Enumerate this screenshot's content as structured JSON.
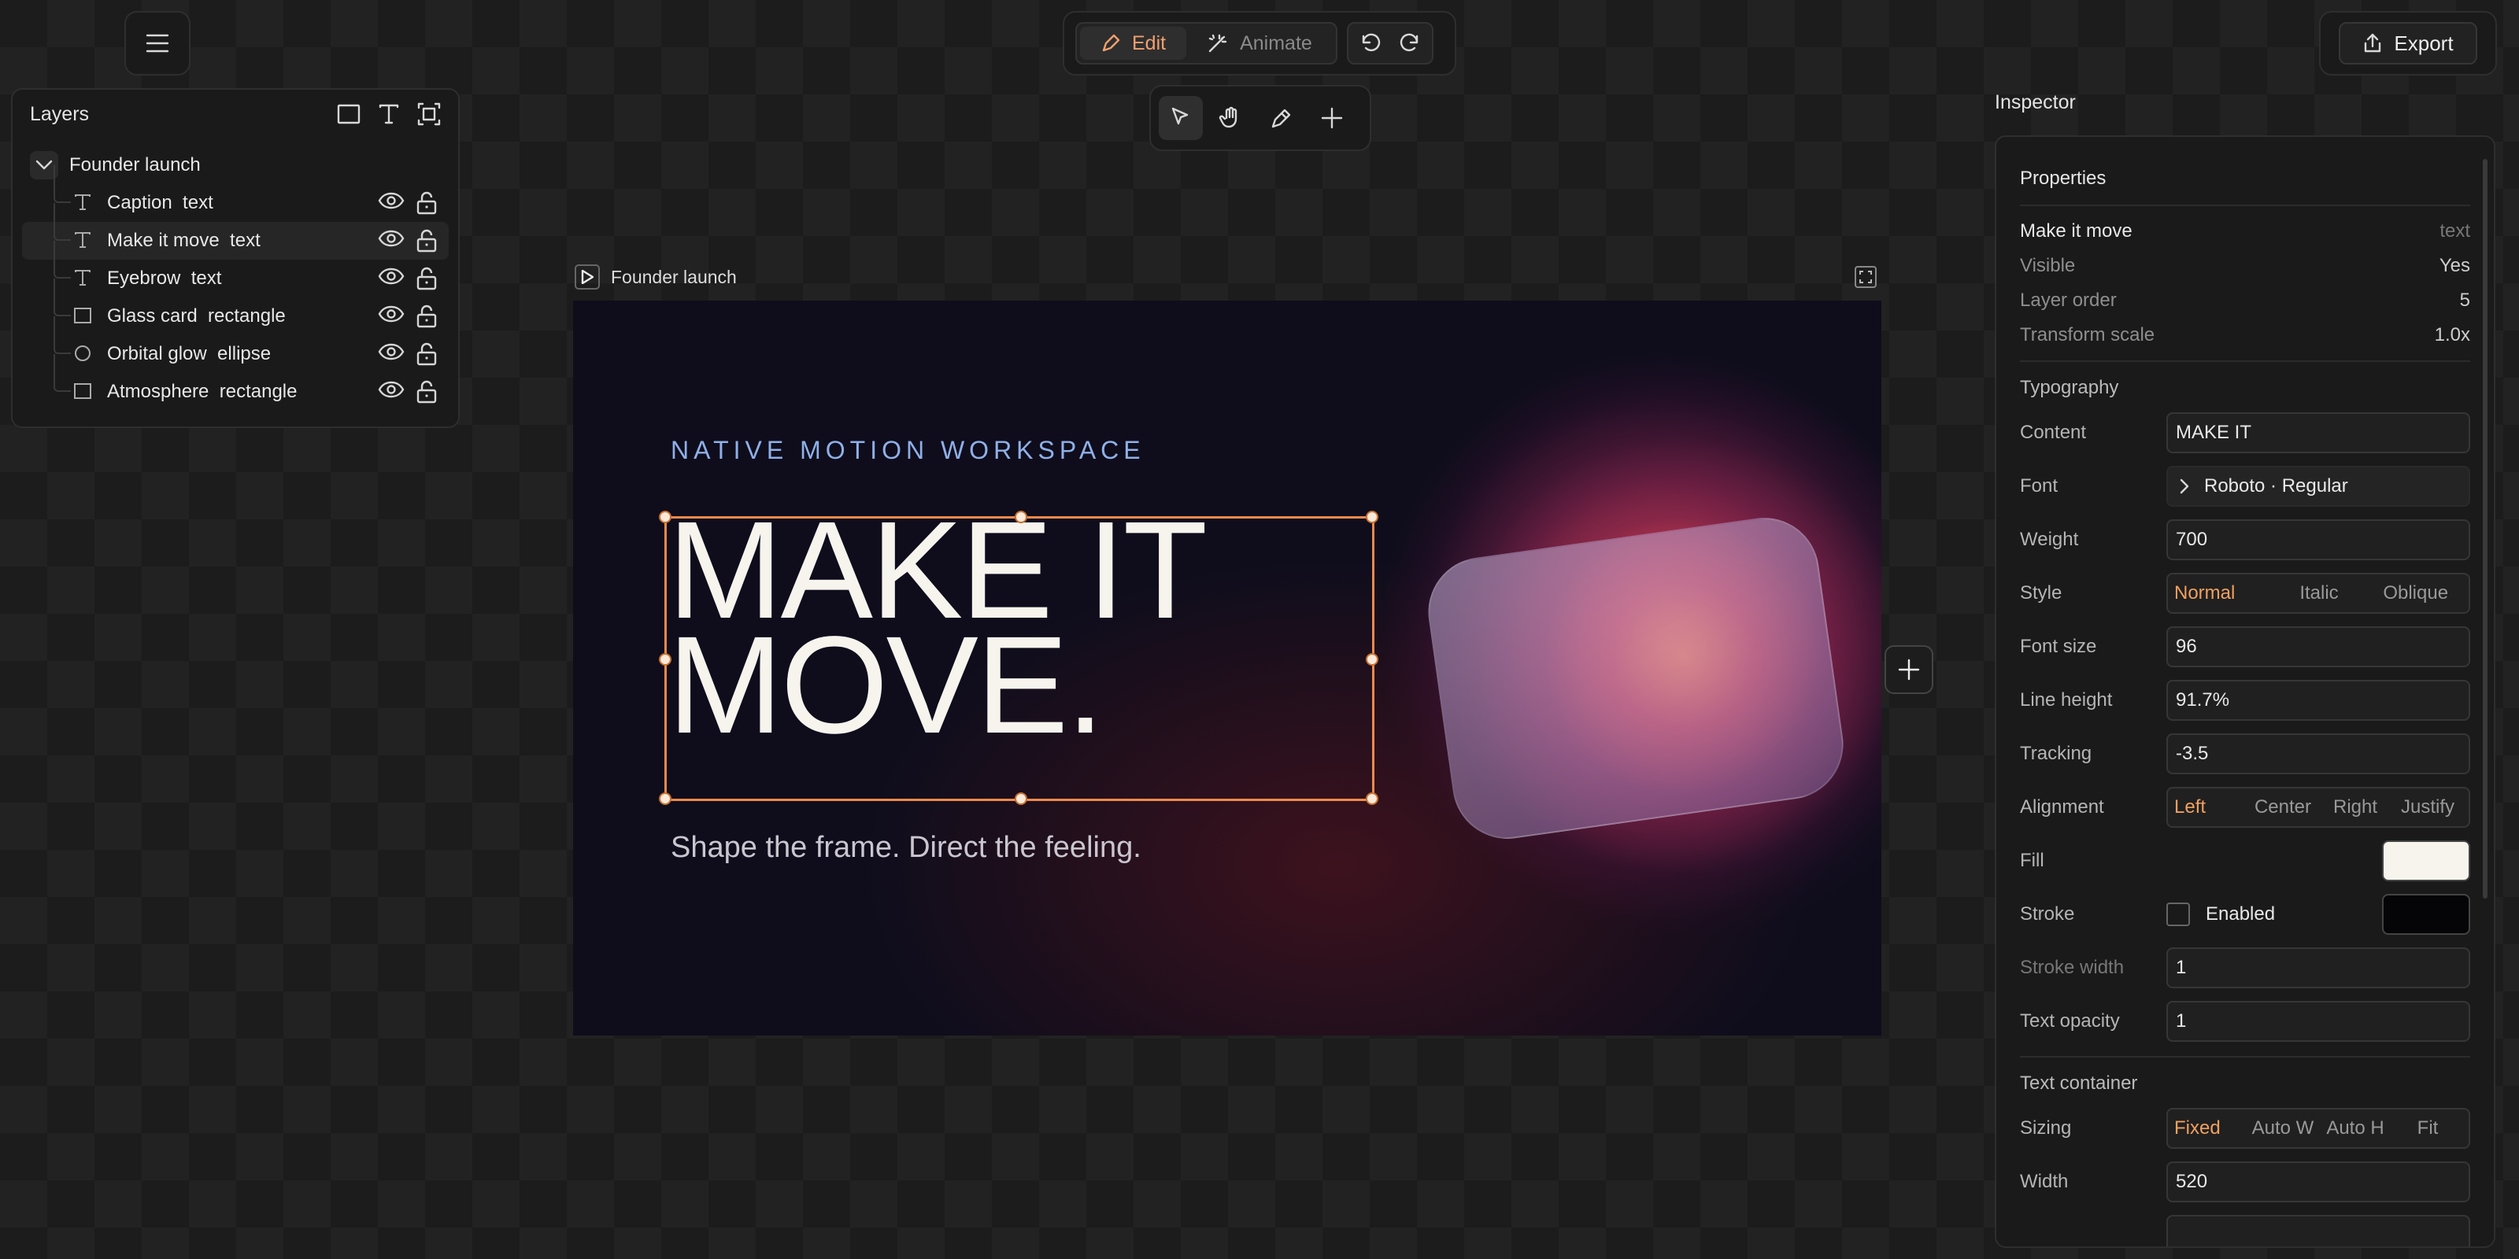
{
  "toolbar": {
    "edit_label": "Edit",
    "animate_label": "Animate",
    "export_label": "Export"
  },
  "layers": {
    "title": "Layers",
    "root": "Founder launch",
    "items": [
      {
        "label": "Caption  text",
        "type": "text"
      },
      {
        "label": "Make it move  text",
        "type": "text"
      },
      {
        "label": "Eyebrow  text",
        "type": "text"
      },
      {
        "label": "Glass card  rectangle",
        "type": "rectangle"
      },
      {
        "label": "Orbital glow  ellipse",
        "type": "ellipse"
      },
      {
        "label": "Atmosphere  rectangle",
        "type": "rectangle"
      }
    ]
  },
  "canvas": {
    "frame_label": "Founder launch",
    "eyebrow": "NATIVE MOTION WORKSPACE",
    "headline": "MAKE IT\nMOVE.",
    "caption": "Shape the frame. Direct the feeling."
  },
  "inspector": {
    "title": "Inspector",
    "properties": {
      "title": "Properties",
      "name": "Make it move",
      "kind": "text",
      "visible_label": "Visible",
      "visible": "Yes",
      "order_label": "Layer order",
      "order": "5",
      "scale_label": "Transform scale",
      "scale": "1.0x"
    },
    "typography": {
      "title": "Typography",
      "content_label": "Content",
      "content": "MAKE IT",
      "font_label": "Font",
      "font": "Roboto · Regular",
      "weight_label": "Weight",
      "weight": "700",
      "style_label": "Style",
      "style_opts": [
        "Normal",
        "Italic",
        "Oblique"
      ],
      "size_label": "Font size",
      "size": "96",
      "lh_label": "Line height",
      "lh": "91.7%",
      "tracking_label": "Tracking",
      "tracking": "-3.5",
      "align_label": "Alignment",
      "align_opts": [
        "Left",
        "Center",
        "Right",
        "Justify"
      ],
      "fill_label": "Fill",
      "stroke_label": "Stroke",
      "stroke_enabled": "Enabled",
      "sw_label": "Stroke width",
      "sw": "1",
      "opacity_label": "Text opacity",
      "opacity": "1"
    },
    "container": {
      "title": "Text container",
      "sizing_label": "Sizing",
      "sizing_opts": [
        "Fixed",
        "Auto W",
        "Auto H",
        "Fit"
      ],
      "width_label": "Width",
      "width": "520"
    }
  },
  "colors": {
    "accent": "#f0a070",
    "fill": "#f7f4ee",
    "stroke": "#050508",
    "eyebrow": "#8fb0e8"
  }
}
